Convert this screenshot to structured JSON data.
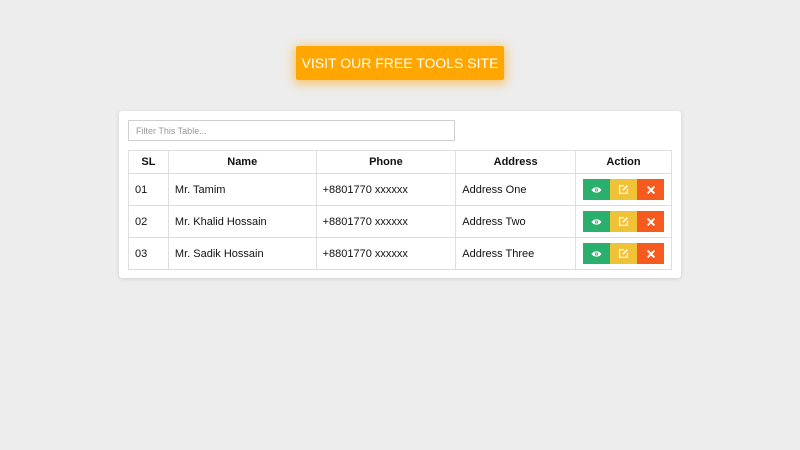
{
  "header": {
    "cta_label": "VISIT OUR FREE TOOLS SITE"
  },
  "filter": {
    "placeholder": "Filter This Table..."
  },
  "table": {
    "columns": [
      "SL",
      "Name",
      "Phone",
      "Address",
      "Action"
    ],
    "rows": [
      {
        "sl": "01",
        "name": "Mr. Tamim",
        "phone": "+8801770 xxxxxx",
        "address": "Address One"
      },
      {
        "sl": "02",
        "name": "Mr. Khalid Hossain",
        "phone": "+8801770 xxxxxx",
        "address": "Address Two"
      },
      {
        "sl": "03",
        "name": "Mr. Sadik Hossain",
        "phone": "+8801770 xxxxxx",
        "address": "Address Three"
      }
    ],
    "action_icons": [
      "eye-icon",
      "edit-icon",
      "close-icon"
    ]
  },
  "colors": {
    "cta": "#ffa600",
    "view": "#2ab06c",
    "edit": "#f0c237",
    "delete": "#f75a1e",
    "background": "#ededed"
  }
}
